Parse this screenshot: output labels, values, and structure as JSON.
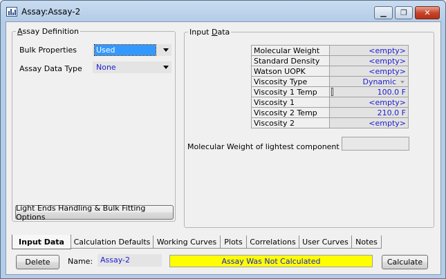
{
  "window": {
    "title": "Assay:Assay-2",
    "minimize_glyph": "▁",
    "maximize_glyph": "❐",
    "close_glyph": "✕"
  },
  "assay_definition": {
    "legend_prefix": "A",
    "legend_rest": "ssay Definition",
    "bulk_properties_label": "Bulk Properties",
    "bulk_properties_value": "Used",
    "assay_data_type_label": "Assay Data Type",
    "assay_data_type_value": "None",
    "light_ends_button": "Light Ends Handling & Bulk Fitting Options"
  },
  "input_data": {
    "legend_prefix": "Input ",
    "legend_underlined": "D",
    "legend_rest": "ata",
    "rows": [
      {
        "key": "Molecular Weight",
        "value": "<empty>"
      },
      {
        "key": "Standard Density",
        "value": "<empty>"
      },
      {
        "key": "Watson UOPK",
        "value": "<empty>"
      },
      {
        "key": "Viscosity Type",
        "value": "Dynamic"
      },
      {
        "key": "Viscosity 1 Temp",
        "value": "100.0 F"
      },
      {
        "key": "Viscosity 1",
        "value": "<empty>"
      },
      {
        "key": "Viscosity 2 Temp",
        "value": "210.0 F"
      },
      {
        "key": "Viscosity 2",
        "value": "<empty>"
      }
    ],
    "lightest_component_label": "Molecular Weight of lightest component"
  },
  "tabs": [
    {
      "label": "Input Data",
      "active": true
    },
    {
      "label": "Calculation Defaults",
      "active": false
    },
    {
      "label": "Working Curves",
      "active": false
    },
    {
      "label": "Plots",
      "active": false
    },
    {
      "label": "Correlations",
      "active": false
    },
    {
      "label": "User Curves",
      "active": false
    },
    {
      "label": "Notes",
      "active": false
    }
  ],
  "footer": {
    "delete_button": "Delete",
    "name_label": "Name:",
    "name_value": "Assay-2",
    "status_text": "Assay Was Not Calculated",
    "status_color": "#ffff00",
    "calculate_button": "Calculate"
  }
}
